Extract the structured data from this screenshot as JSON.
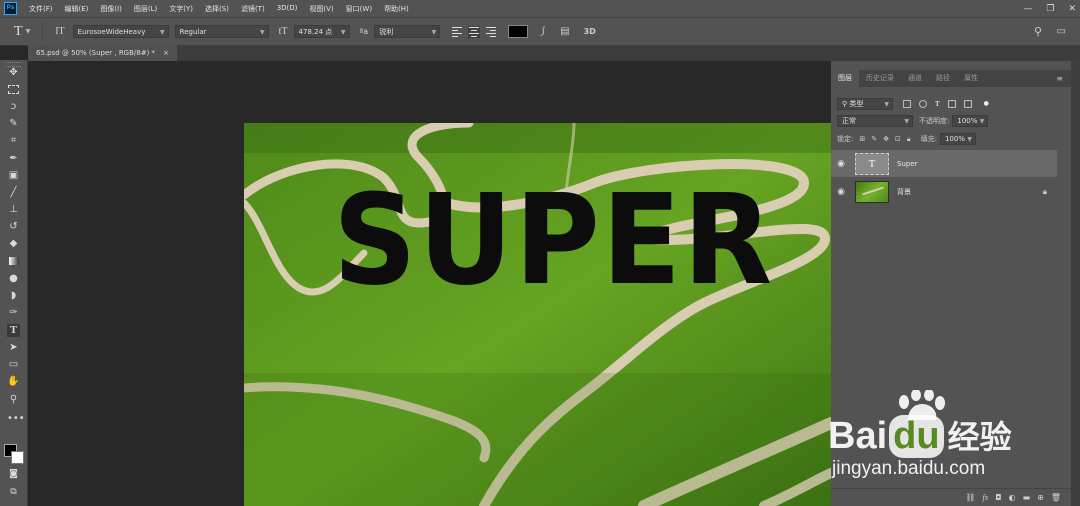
{
  "app": {
    "logo": "Ps"
  },
  "menu": [
    "文件(F)",
    "编辑(E)",
    "图像(I)",
    "图层(L)",
    "文字(Y)",
    "选择(S)",
    "滤镜(T)",
    "3D(D)",
    "视图(V)",
    "窗口(W)",
    "帮助(H)"
  ],
  "window_controls": {
    "minimize": "—",
    "restore": "❐",
    "close": "✕"
  },
  "options": {
    "tool_glyph": "T",
    "font_family": "EurosoeWideHeavy",
    "font_style": "Regular",
    "font_size": "478.24 点",
    "aa_icon": "ªa",
    "antialias": "锐利",
    "text_color": "#000000",
    "label_3d": "3D"
  },
  "document_tab": {
    "title": "65.psd @ 50% (Super , RGB/8#) *",
    "close": "×"
  },
  "canvas": {
    "text": "SUPER",
    "text_color": "#0c0c0c"
  },
  "layers_panel": {
    "tabs": [
      "图层",
      "历史记录",
      "通道",
      "路径",
      "属性"
    ],
    "active_tab": "图层",
    "filter_label": "类型",
    "blend_mode": "正常",
    "opacity_label": "不透明度:",
    "opacity_value": "100%",
    "lock_label": "锁定:",
    "fill_label": "填充:",
    "fill_value": "100%",
    "layers": [
      {
        "name": "Super",
        "thumb_glyph": "T",
        "selected": true,
        "type": "text"
      },
      {
        "name": "背景",
        "selected": false,
        "type": "image",
        "locked": true
      }
    ]
  },
  "watermark": {
    "brand_left": "Bai",
    "brand_right": "du",
    "label": "经验",
    "url": "jingyan.baidu.com"
  },
  "colors": {
    "bg": "#282828",
    "panel": "#535353",
    "accent": "#31a8ff",
    "grass": "#5e9a1f",
    "path": "#d8cdb0"
  }
}
